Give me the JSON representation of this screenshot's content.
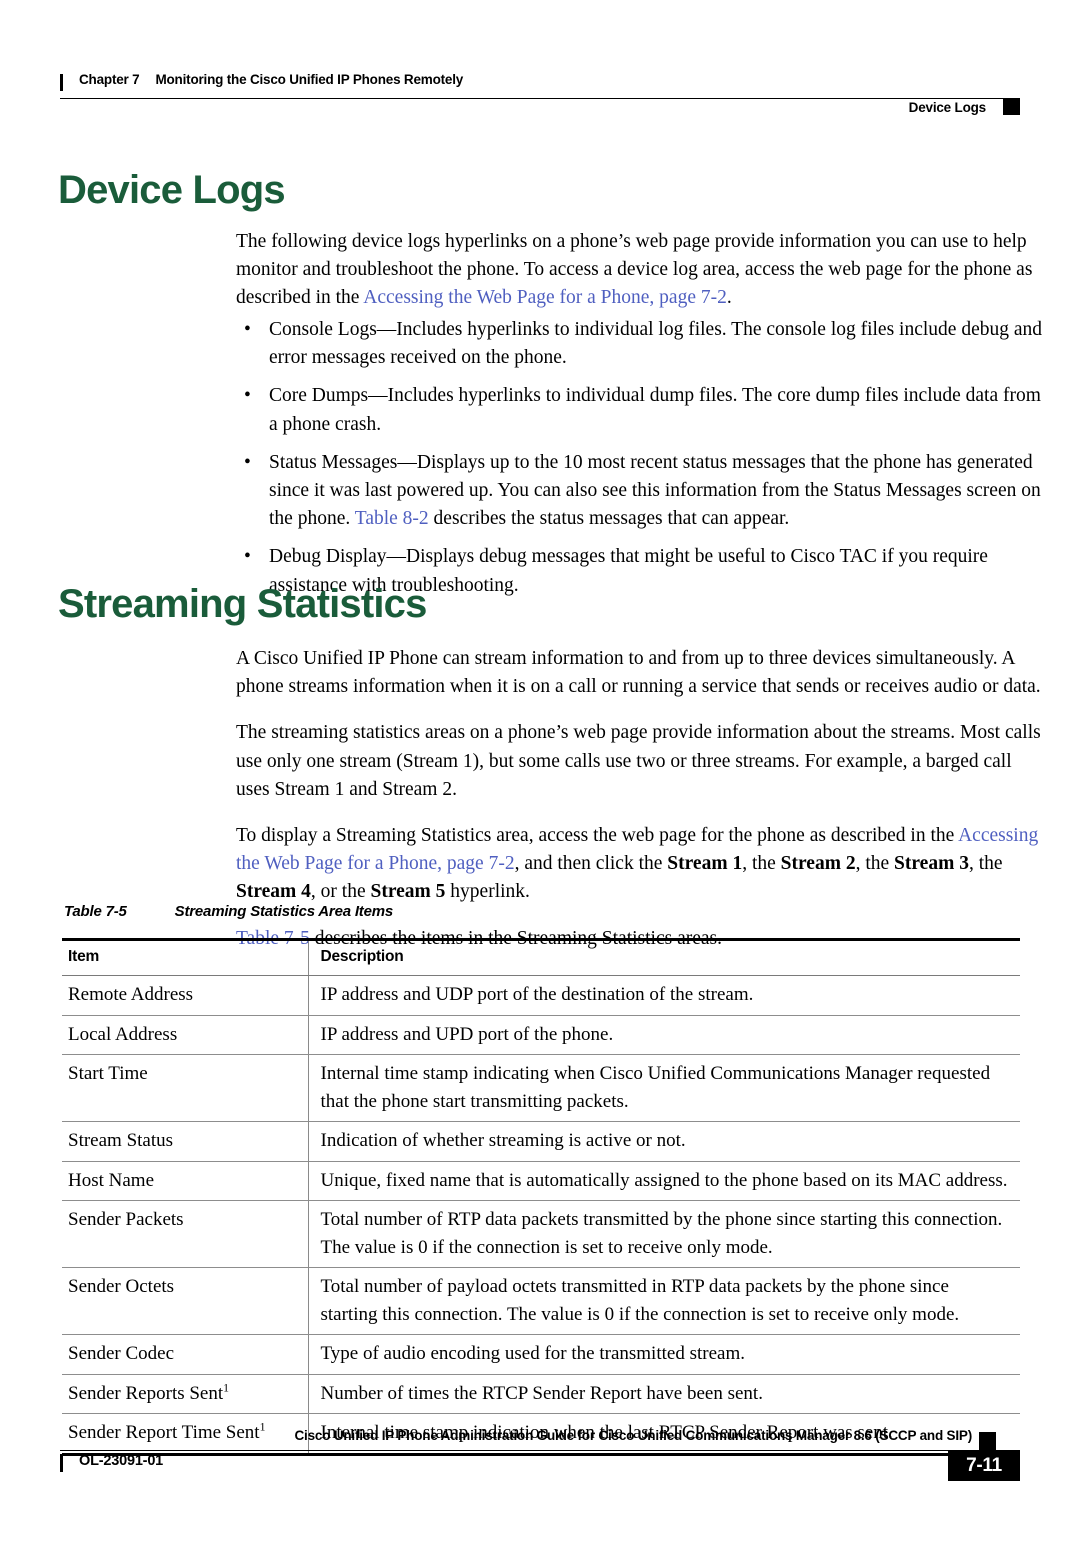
{
  "header": {
    "chapter_label": "Chapter 7",
    "chapter_title": "Monitoring the Cisco Unified IP Phones Remotely",
    "running_head": "Device Logs"
  },
  "sections": {
    "device_logs": {
      "heading": "Device Logs",
      "intro_pre": "The following device logs hyperlinks on a phone’s web page provide information you can use to help monitor and troubleshoot the phone. To access a device log area, access the web page for the phone as described in the ",
      "intro_link": "Accessing the Web Page for a Phone, page 7-2",
      "intro_post": ".",
      "bullets": [
        {
          "text": "Console Logs—Includes hyperlinks to individual log files. The console log files include debug and error messages received on the phone."
        },
        {
          "text": "Core Dumps—Includes hyperlinks to individual dump files. The core dump files include data from a phone crash."
        },
        {
          "pre": "Status Messages—Displays up to the 10 most recent status messages that the phone has generated since it was last powered up. You can also see this information from the Status Messages screen on the phone. ",
          "link": "Table 8-2",
          "post": " describes the status messages that can appear."
        },
        {
          "text": "Debug Display—Displays debug messages that might be useful to Cisco TAC if you require assistance with troubleshooting."
        }
      ]
    },
    "streaming_statistics": {
      "heading": "Streaming Statistics",
      "para1": "A Cisco Unified IP Phone can stream information to and from up to three devices simultaneously. A phone streams information when it is on a call or running a service that sends or receives audio or data.",
      "para2": "The streaming statistics areas on a phone’s web page provide information about the streams. Most calls use only one stream (Stream 1), but some calls use two or three streams. For example, a barged call uses Stream 1 and Stream 2.",
      "para3_pre": "To display a Streaming Statistics area, access the web page for the phone as described in the ",
      "para3_link": "Accessing the Web Page for a Phone, page 7-2",
      "para3_mid1": ", and then click the ",
      "para3_b1": "Stream 1",
      "para3_mid2": ", the ",
      "para3_b2": "Stream 2",
      "para3_mid3": ", the ",
      "para3_b3": "Stream 3",
      "para3_mid4": ", the ",
      "para3_b4": "Stream 4",
      "para3_mid5": ", or the ",
      "para3_b5": "Stream 5",
      "para3_post": " hyperlink.",
      "para4_link": "Table 7-5",
      "para4_post": " describes the items in the Streaming Statistics areas."
    }
  },
  "table": {
    "caption_number": "Table 7-5",
    "caption_title": "Streaming Statistics Area Items",
    "columns": [
      "Item",
      "Description"
    ],
    "rows": [
      {
        "item": "Remote Address",
        "footnote": "",
        "description": "IP address and UDP port of the destination of the stream."
      },
      {
        "item": "Local Address",
        "footnote": "",
        "description": "IP address and UPD port of the phone."
      },
      {
        "item": "Start Time",
        "footnote": "",
        "description": "Internal time stamp indicating when Cisco Unified Communications Manager requested that the phone start transmitting packets."
      },
      {
        "item": "Stream Status",
        "footnote": "",
        "description": "Indication of whether streaming is active or not."
      },
      {
        "item": "Host Name",
        "footnote": "",
        "description": "Unique, fixed name that is automatically assigned to the phone based on its MAC address."
      },
      {
        "item": "Sender Packets",
        "footnote": "",
        "description": "Total number of RTP data packets transmitted by the phone since starting this connection. The value is 0 if the connection is set to receive only mode."
      },
      {
        "item": "Sender Octets",
        "footnote": "",
        "description": "Total number of payload octets transmitted in RTP data packets by the phone since starting this connection. The value is 0 if the connection is set to receive only mode."
      },
      {
        "item": "Sender Codec",
        "footnote": "",
        "description": "Type of audio encoding used for the transmitted stream."
      },
      {
        "item": "Sender Reports Sent",
        "footnote": "1",
        "description": "Number of times the RTCP Sender Report have been sent."
      },
      {
        "item": "Sender Report Time Sent",
        "footnote": "1",
        "description": "Internal time stamp indication when the last RTCP Sender Report was sent."
      }
    ]
  },
  "footer": {
    "guide_title": "Cisco Unified IP Phone Administration Guide for Cisco Unified Communications Manager 8.6 (SCCP and SIP)",
    "doc_id": "OL-23091-01",
    "page_number": "7-11"
  },
  "colors": {
    "heading_green": "#1a5c3a",
    "link_blue": "#4f5fc0",
    "rule_black": "#000000"
  }
}
